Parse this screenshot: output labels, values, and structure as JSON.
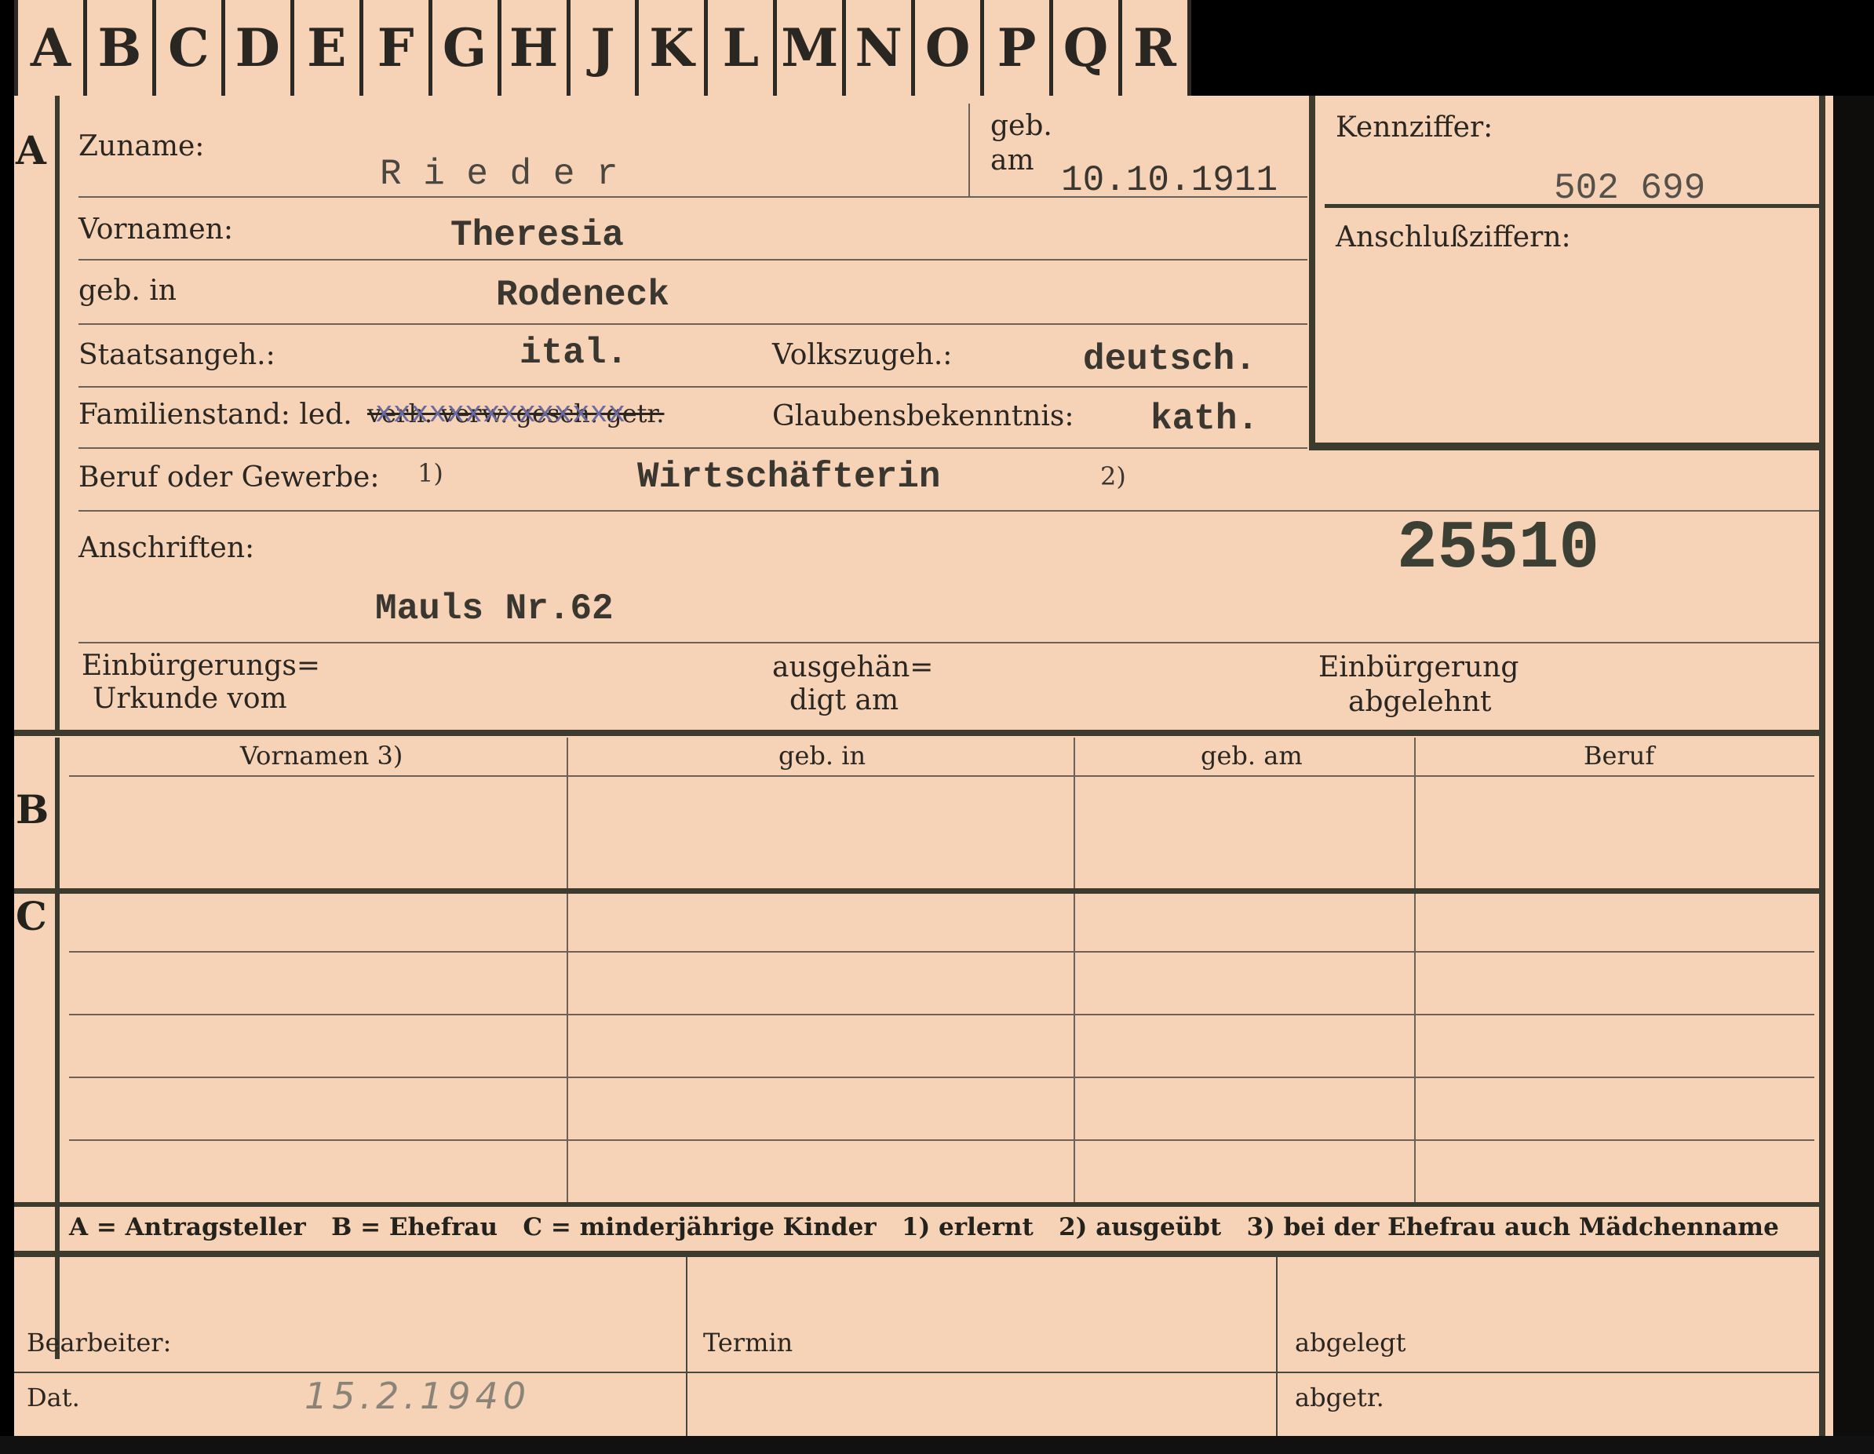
{
  "tabs": [
    "A",
    "B",
    "C",
    "D",
    "E",
    "F",
    "G",
    "H",
    "J",
    "K",
    "L",
    "M",
    "N",
    "O",
    "P",
    "Q",
    "R"
  ],
  "section_letters": {
    "a": "A",
    "b": "B",
    "c": "C"
  },
  "labels": {
    "zuname": "Zuname:",
    "geb_am_1": "geb.",
    "geb_am_2": "am",
    "kennziffer": "Kennziffer:",
    "anschlussziffern": "Anschlußziffern:",
    "vornamen": "Vornamen:",
    "geb_in": "geb. in",
    "staatsangeh": "Staatsangeh.:",
    "volkszugeh": "Volkszugeh.:",
    "familienstand": "Familienstand: led.",
    "familienstand_struck": "verh. verw. gesch. getr.",
    "familienstand_overtype": "xxxxxxxxxxxxxx",
    "glaubensbekenntnis": "Glaubensbekenntnis:",
    "beruf": "Beruf oder Gewerbe:",
    "beruf_sup1": "1)",
    "beruf_sup2": "2)",
    "anschriften": "Anschriften:",
    "einbuergerungs_1": "Einbürgerungs=",
    "einbuergerungs_2": "Urkunde vom",
    "ausgehaen_1": "ausgehän=",
    "ausgehaen_2": "digt am",
    "einbuergerung_abg_1": "Einbürgerung",
    "einbuergerung_abg_2": "abgelehnt"
  },
  "values": {
    "zuname": "R i e d e r",
    "geb_am": "10.10.1911",
    "kennziffer": "502 699",
    "vornamen": "Theresia",
    "geb_in": "Rodeneck",
    "staatsangeh": "ital.",
    "volkszugeh": "deutsch.",
    "glaubensbekenntnis": "kath.",
    "beruf": "Wirtschäfterin",
    "number": "25510",
    "anschrift": "Mauls Nr.62",
    "datum": "15.2.1940"
  },
  "table_headers": [
    "Vornamen 3)",
    "geb. in",
    "geb. am",
    "Beruf"
  ],
  "legend": "A = Antragsteller   B = Ehefrau   C = minderjährige Kinder   1) erlernt   2) ausgeübt   3) bei der Ehefrau auch Mädchenname",
  "footer": {
    "bearbeiter": "Bearbeiter:",
    "dat": "Dat.",
    "termin": "Termin",
    "abgelegt": "abgelegt",
    "abgetr": "abgetr."
  }
}
